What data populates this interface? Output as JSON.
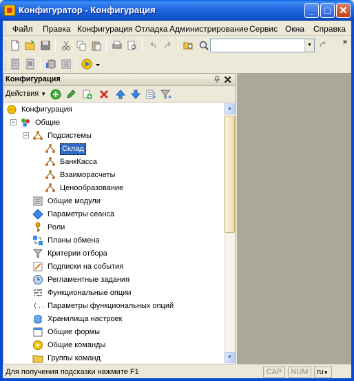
{
  "window": {
    "title": "Конфигуратор - Конфигурация",
    "controls": {
      "minimize": "_",
      "maximize": "□",
      "close": "✕"
    }
  },
  "menu": {
    "items": [
      "Файл",
      "Правка",
      "Конфигурация",
      "Отладка",
      "Администрирование",
      "Сервис",
      "Окна",
      "Справка"
    ],
    "more": "»"
  },
  "toolbar": {
    "search": {
      "value": "",
      "placeholder": ""
    },
    "more": "»"
  },
  "panel": {
    "title": "Конфигурация",
    "close": "✕",
    "actions_label": "Действия"
  },
  "tree": {
    "root": "Конфигурация",
    "common": "Общие",
    "subsystems": "Подсистемы",
    "subsystem_items": [
      "Склад",
      "БанкКасса",
      "Взаиморасчеты",
      "Ценообразование"
    ],
    "selected": "Склад",
    "items": [
      {
        "label": "Общие модули",
        "icon": "common-modules-icon"
      },
      {
        "label": "Параметры сеанса",
        "icon": "session-params-icon"
      },
      {
        "label": "Роли",
        "icon": "key-icon"
      },
      {
        "label": "Планы обмена",
        "icon": "exchange-plans-icon"
      },
      {
        "label": "Критерии отбора",
        "icon": "filter-icon"
      },
      {
        "label": "Подписки на события",
        "icon": "event-subscription-icon"
      },
      {
        "label": "Регламентные задания",
        "icon": "clock-icon"
      },
      {
        "label": "Функциональные опции",
        "icon": "functional-options-icon"
      },
      {
        "label": "Параметры функциональных опций",
        "icon": "functional-params-icon"
      },
      {
        "label": "Хранилища настроек",
        "icon": "settings-storage-icon"
      },
      {
        "label": "Общие формы",
        "icon": "forms-icon"
      },
      {
        "label": "Общие команды",
        "icon": "commands-icon"
      },
      {
        "label": "Группы команд",
        "icon": "folder-icon"
      }
    ]
  },
  "status": {
    "hint": "Для получения подсказки нажмите F1",
    "cap": "CAP",
    "num": "NUM",
    "lang": "ru"
  },
  "colors": {
    "titlebar": "#2266e0",
    "selection": "#316ac5",
    "workspace": "#aca899"
  }
}
